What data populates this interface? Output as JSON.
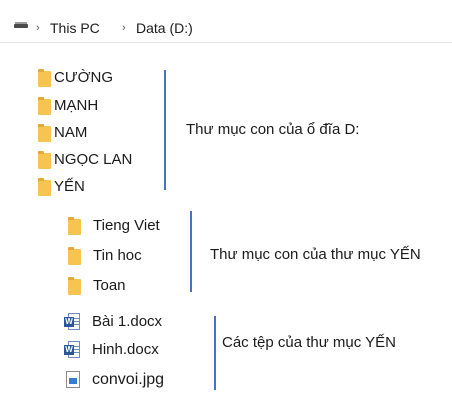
{
  "breadcrumb": {
    "drive_icon": "drive-icon",
    "sep": "›",
    "items": [
      "This PC",
      "Data (D:)"
    ]
  },
  "drive_folders": [
    "CƯỜNG",
    "MẠNH",
    "NAM",
    "NGỌC LAN",
    "YẾN"
  ],
  "yen_subfolders": [
    "Tieng Viet",
    "Tin hoc",
    "Toan"
  ],
  "yen_files": [
    {
      "name": "Bài 1.docx",
      "icon": "word-document-icon"
    },
    {
      "name": "Hinh.docx",
      "icon": "word-document-icon"
    },
    {
      "name": "convoi.jpg",
      "icon": "image-file-icon"
    }
  ],
  "annotations": {
    "drive_subfolders": "Thư mục con của ổ đĩa D:",
    "yen_subfolders": "Thư mục con của thư mục YẾN",
    "yen_files": "Các tệp của thư mục YẾN"
  },
  "colors": {
    "folder": "#f5c451",
    "bracket_line": "#4472c4",
    "word_badge": "#2b5797"
  }
}
